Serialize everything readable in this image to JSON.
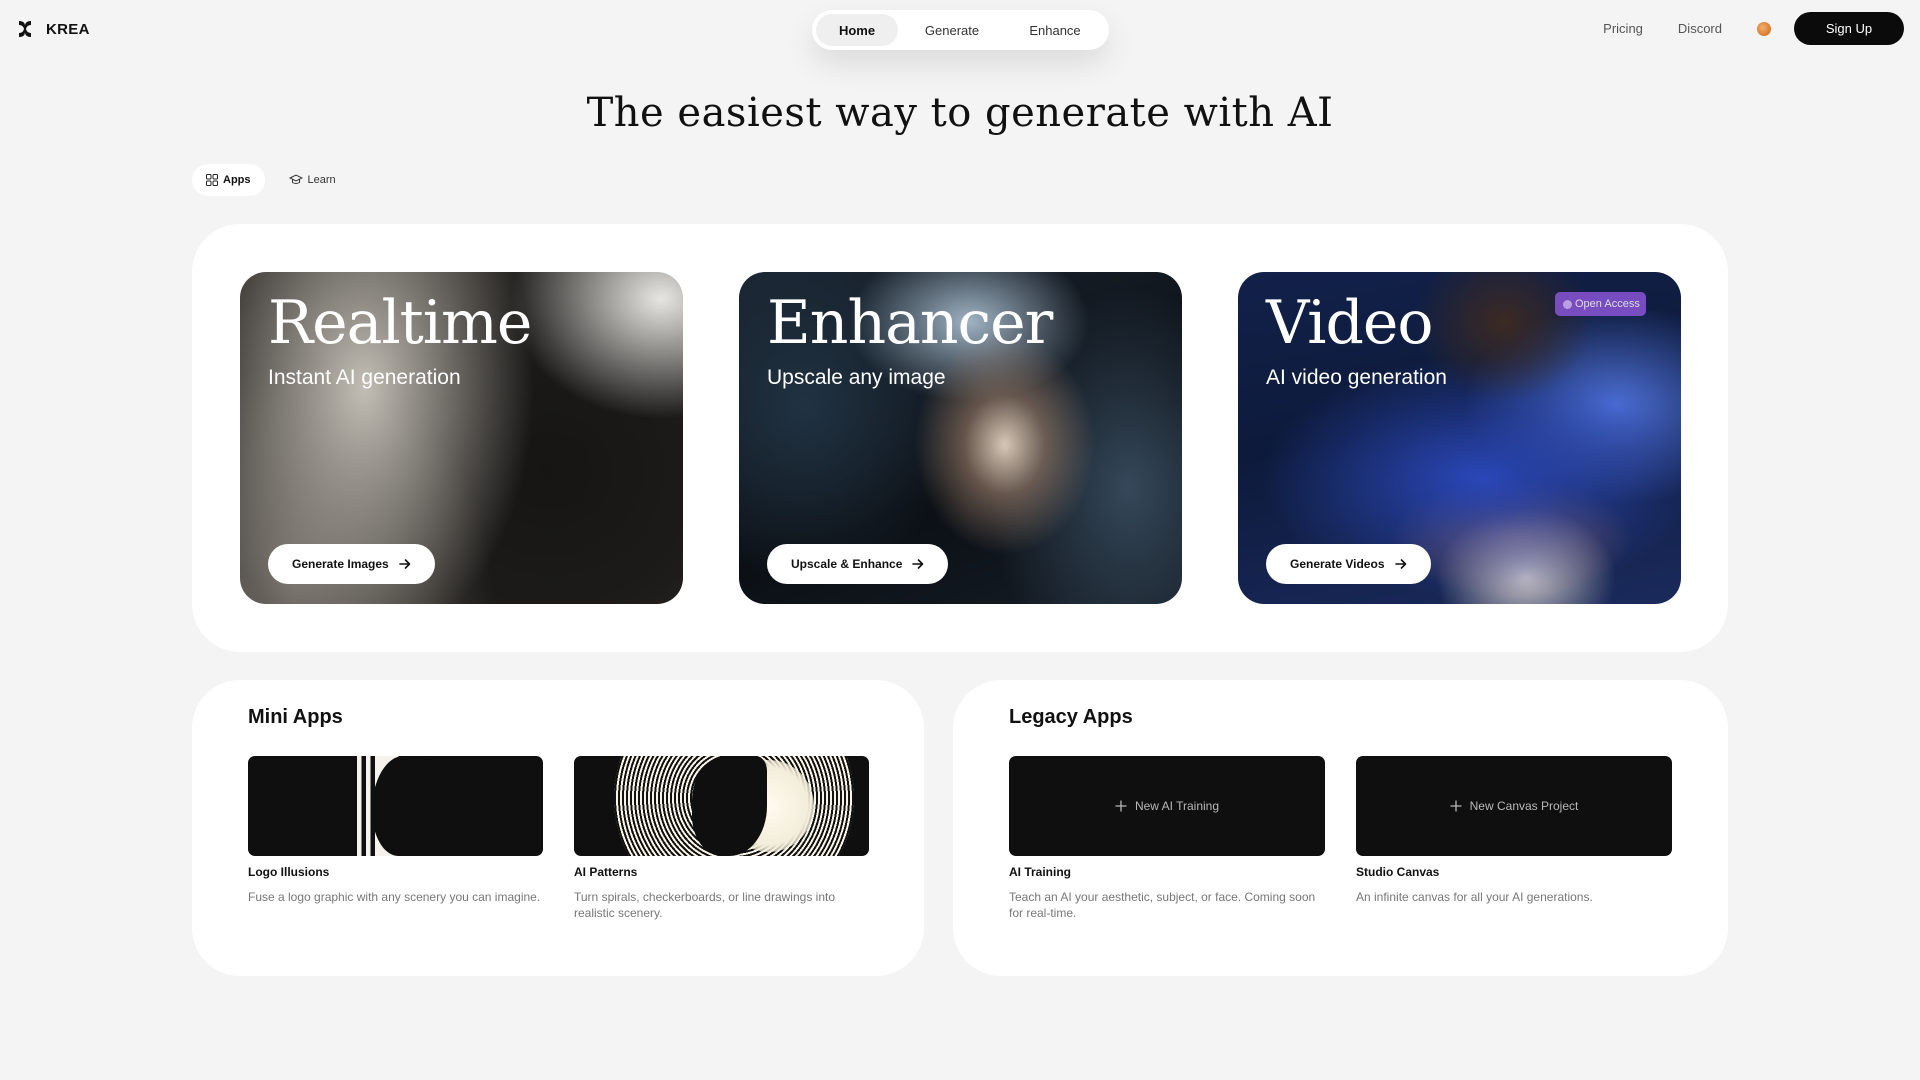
{
  "brand": {
    "name": "KREA"
  },
  "nav": {
    "tabs": [
      {
        "label": "Home",
        "active": true
      },
      {
        "label": "Generate",
        "active": false
      },
      {
        "label": "Enhance",
        "active": false
      }
    ],
    "right_links": [
      "Pricing",
      "Discord"
    ],
    "signup_label": "Sign Up"
  },
  "hero": {
    "title": "The easiest way to generate with AI"
  },
  "subtabs": [
    {
      "label": "Apps",
      "icon": "grid-icon",
      "active": true
    },
    {
      "label": "Learn",
      "icon": "graduation-cap-icon",
      "active": false
    }
  ],
  "features": [
    {
      "title": "Realtime",
      "subtitle": "Instant AI generation",
      "button": "Generate Images"
    },
    {
      "title": "Enhancer",
      "subtitle": "Upscale any image",
      "button": "Upscale & Enhance"
    },
    {
      "title": "Video",
      "subtitle": "AI video generation",
      "button": "Generate Videos",
      "badge": "Open Access"
    }
  ],
  "mini_apps": {
    "title": "Mini Apps",
    "items": [
      {
        "name": "Logo Illusions",
        "desc": "Fuse a logo graphic with any scenery you can imagine."
      },
      {
        "name": "AI Patterns",
        "desc": "Turn spirals, checkerboards, or line drawings into realistic scenery."
      }
    ]
  },
  "legacy_apps": {
    "title": "Legacy Apps",
    "items": [
      {
        "name": "AI Training",
        "action": "New AI Training",
        "desc": "Teach an AI your aesthetic, subject, or face. Coming soon for real-time."
      },
      {
        "name": "Studio Canvas",
        "action": "New Canvas Project",
        "desc": "An infinite canvas for all your AI generations."
      }
    ]
  },
  "colors": {
    "background": "#f4f4f4",
    "panel": "#ffffff",
    "primary_button": "#0b0b0b",
    "badge": "#8a55d6"
  }
}
